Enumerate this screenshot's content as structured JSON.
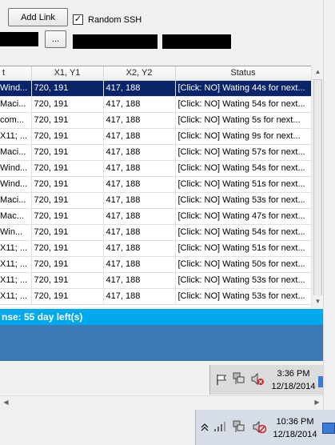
{
  "toolbar": {
    "add_link_label": "Add Link",
    "random_ssh_checked": "✓",
    "random_ssh_label": "Random SSH",
    "browse_label": "..."
  },
  "grid": {
    "columns": [
      "t",
      "X1, Y1",
      "X2, Y2",
      "Status"
    ],
    "rows": [
      [
        "Wind...",
        "720, 191",
        "417, 188",
        "[Click: NO] Wating 44s for next..."
      ],
      [
        "Maci...",
        "720, 191",
        "417, 188",
        "[Click: NO] Wating 54s for next..."
      ],
      [
        "com...",
        "720, 191",
        "417, 188",
        "[Click: NO] Wating 5s for next..."
      ],
      [
        "X11; ...",
        "720, 191",
        "417, 188",
        "[Click: NO] Wating 9s for next..."
      ],
      [
        "Maci...",
        "720, 191",
        "417, 188",
        "[Click: NO] Wating 57s for next..."
      ],
      [
        "Wind...",
        "720, 191",
        "417, 188",
        "[Click: NO] Wating 54s for next..."
      ],
      [
        "Wind...",
        "720, 191",
        "417, 188",
        "[Click: NO] Wating 51s for next..."
      ],
      [
        "Maci...",
        "720, 191",
        "417, 188",
        "[Click: NO] Wating 53s for next..."
      ],
      [
        "Mac...",
        "720, 191",
        "417, 188",
        "[Click: NO] Wating 47s for next..."
      ],
      [
        "Win...",
        "720, 191",
        "417, 188",
        "[Click: NO] Wating 54s for next..."
      ],
      [
        "X11; ...",
        "720, 191",
        "417, 188",
        "[Click: NO] Wating 51s for next..."
      ],
      [
        "X11; ...",
        "720, 191",
        "417, 188",
        "[Click: NO] Wating 50s for next..."
      ],
      [
        "X11; ...",
        "720, 191",
        "417, 188",
        "[Click: NO] Wating 53s for next..."
      ],
      [
        "X11; ...",
        "720, 191",
        "417, 188",
        "[Click: NO] Wating 53s for next..."
      ]
    ],
    "selected_row": 0
  },
  "license": {
    "text": "nse: 55 day left(s)"
  },
  "inner_taskbar": {
    "time": "3:36 PM",
    "date": "12/18/2014",
    "icons": [
      "flag-icon",
      "network-icon",
      "volume-muted-icon"
    ]
  },
  "outer_taskbar": {
    "time": "10:36 PM",
    "date": "12/18/2014",
    "icons": [
      "chevron-up-icon",
      "signal-icon",
      "network-icon",
      "volume-muted-icon"
    ]
  },
  "colors": {
    "selection": "#0a246a",
    "license_bar": "#00a8ec",
    "panel": "#3c78b3"
  }
}
